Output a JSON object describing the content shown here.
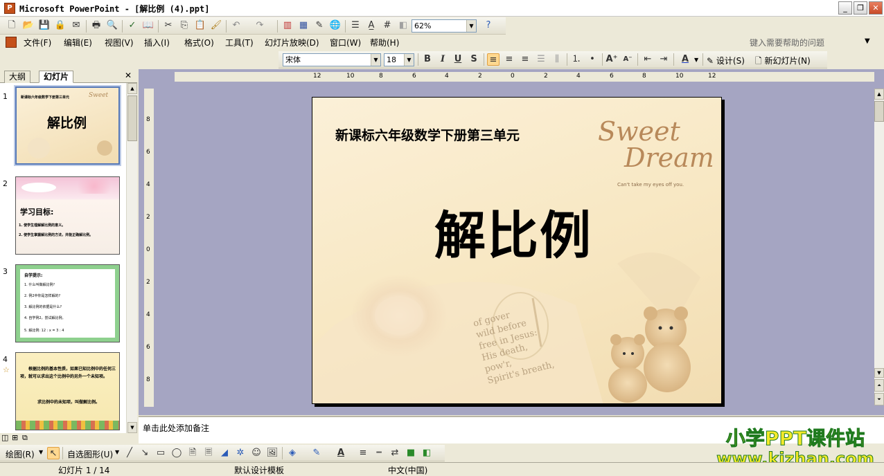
{
  "window": {
    "title": "Microsoft PowerPoint - [解比例 (4).ppt]",
    "buttons": {
      "minimize": "_",
      "maximize": "❐",
      "close": "✕"
    }
  },
  "standard_toolbar": {
    "zoom": "62%"
  },
  "menu": {
    "items": [
      "文件(F)",
      "编辑(E)",
      "视图(V)",
      "插入(I)",
      "格式(O)",
      "工具(T)",
      "幻灯片放映(D)",
      "窗口(W)",
      "帮助(H)"
    ],
    "help_placeholder": "键入需要帮助的问题"
  },
  "format_toolbar": {
    "font": "宋体",
    "size": "18",
    "bold": "B",
    "italic": "I",
    "underline": "U",
    "shadow": "S",
    "design_label": "设计(S)",
    "new_slide_label": "新幻灯片(N)"
  },
  "left_pane": {
    "tabs": [
      "大纲",
      "幻灯片"
    ],
    "close": "✕",
    "slides": [
      {
        "number": "1",
        "heading": "新课标六年级数学下册第三单元",
        "title": "解比例"
      },
      {
        "number": "2",
        "heading": "学习目标:",
        "lines": [
          "1. 使学生理解解比例的意义。",
          "2. 使学生掌握解比例的方法，并能正确解比例。"
        ]
      },
      {
        "number": "3",
        "heading": "自学提示:",
        "lines": [
          "1. 什么叫做解比例?",
          "2. 例2中你是怎样解的?",
          "3. 解比例的依据是什么?",
          "4. 自学例2，尝试解比例。",
          "5. 解比例: 12 : x = 3 : 4"
        ]
      },
      {
        "number": "4",
        "lines": [
          "根据比例的基本性质，如果已知比例中的任何三项，就可以求出这个比例中的另外一个未知项。",
          "求比例中的未知项，叫做解比例。"
        ]
      }
    ]
  },
  "slide": {
    "subtitle": "新课标六年级数学下册第三单元",
    "title": "解比例",
    "logo_line1": "Sweet",
    "logo_line2": "Dream",
    "logo_tagline": "Can't take my eyes off you.",
    "book_text": [
      "free in Jesus:",
      "His death,",
      "pow'r,",
      "Spirit's breath,",
      "wild before",
      "of gover"
    ]
  },
  "ruler": {
    "h_labels": [
      "12",
      "10",
      "8",
      "6",
      "4",
      "2",
      "0",
      "2",
      "4",
      "6",
      "8",
      "10",
      "12"
    ],
    "v_labels": [
      "8",
      "6",
      "4",
      "2",
      "0",
      "2",
      "4",
      "6",
      "8"
    ]
  },
  "notes": {
    "placeholder": "单击此处添加备注"
  },
  "drawing_toolbar": {
    "draw_label": "绘图(R)",
    "autoshapes_label": "自选图形(U)"
  },
  "statusbar": {
    "slide_info": "幻灯片 1 / 14",
    "template": "默认设计模板",
    "language": "中文(中国)"
  },
  "watermark": {
    "line1": "小学PPT课件站",
    "line2": "www.kjzhan.com"
  },
  "colors": {
    "accent": "#2f5ea8",
    "watermark_fill": "#f4ea2a",
    "watermark_stroke": "#1e7a1e",
    "workspace": "#a5a5c2"
  }
}
